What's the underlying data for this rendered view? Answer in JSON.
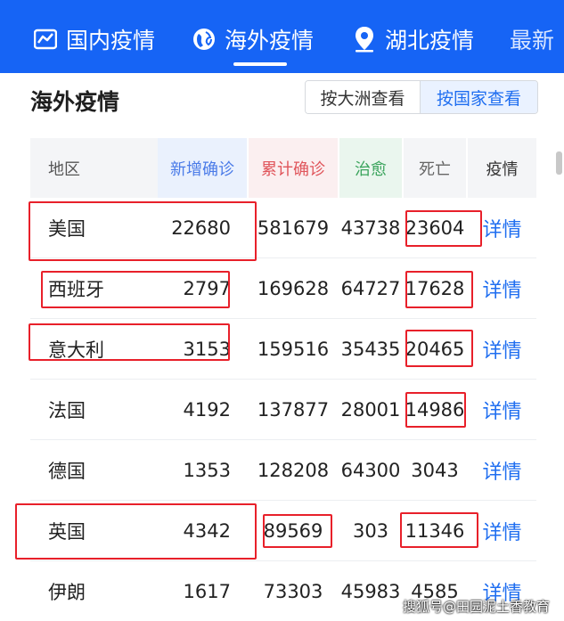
{
  "tabs": [
    {
      "label": "国内疫情",
      "icon": "chart-line-icon",
      "active": false
    },
    {
      "label": "海外疫情",
      "icon": "globe-icon",
      "active": true
    },
    {
      "label": "湖北疫情",
      "icon": "location-pin-icon",
      "active": false
    },
    {
      "label": "最新",
      "icon": "",
      "active": false
    }
  ],
  "section": {
    "title": "海外疫情",
    "toggle": {
      "by_continent": "按大洲查看",
      "by_country": "按国家查看",
      "selected": "by_country"
    }
  },
  "table": {
    "headers": {
      "region": "地区",
      "new_confirmed": "新增确诊",
      "total_confirmed": "累计确诊",
      "cured": "治愈",
      "deaths": "死亡",
      "detail": "疫情"
    },
    "rows": [
      {
        "name": "美国",
        "new": "22680",
        "total": "581679",
        "cured": "43738",
        "dead": "23604",
        "detail": "详情"
      },
      {
        "name": "西班牙",
        "new": "2797",
        "total": "169628",
        "cured": "64727",
        "dead": "17628",
        "detail": "详情"
      },
      {
        "name": "意大利",
        "new": "3153",
        "total": "159516",
        "cured": "35435",
        "dead": "20465",
        "detail": "详情"
      },
      {
        "name": "法国",
        "new": "4192",
        "total": "137877",
        "cured": "28001",
        "dead": "14986",
        "detail": "详情"
      },
      {
        "name": "德国",
        "new": "1353",
        "total": "128208",
        "cured": "64300",
        "dead": "3043",
        "detail": "详情"
      },
      {
        "name": "英国",
        "new": "4342",
        "total": "89569",
        "cured": "303",
        "dead": "11346",
        "detail": "详情"
      },
      {
        "name": "伊朗",
        "new": "1617",
        "total": "73303",
        "cured": "45983",
        "dead": "4585",
        "detail": "详情"
      }
    ]
  },
  "colors": {
    "brand": "#1664f5",
    "annotation": "#e8202a",
    "new_header": "#4a7be8",
    "total_header": "#e0555b",
    "cured_header": "#3aa45c",
    "link": "#1f6ef0"
  },
  "watermark": "搜狐号@田园泥土香教育"
}
